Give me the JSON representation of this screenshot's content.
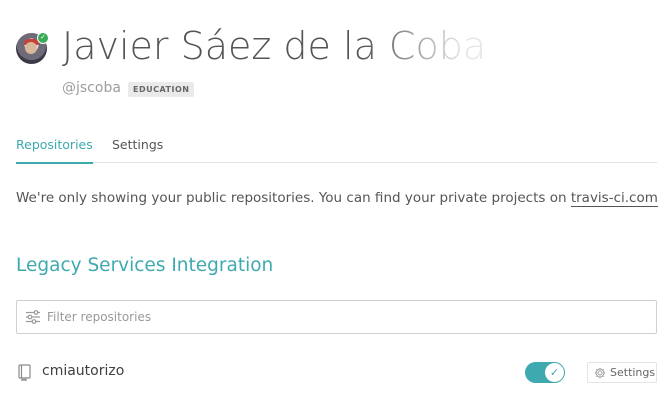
{
  "profile": {
    "name": "Javier Sáez de la Coba",
    "handle": "@jscoba",
    "badge": "EDUCATION",
    "avatar_icon": "user-avatar",
    "status_icon": "check-icon"
  },
  "tabs": [
    {
      "label": "Repositories",
      "active": true
    },
    {
      "label": "Settings",
      "active": false
    }
  ],
  "notice": {
    "text": "We're only showing your public repositories. You can find your private projects on",
    "link_text": "travis-ci.com",
    "suffix": "."
  },
  "section": {
    "title": "Legacy Services Integration"
  },
  "filter": {
    "placeholder": "Filter repositories",
    "value": ""
  },
  "repositories": [
    {
      "name": "cmiautorizo",
      "active": true,
      "settings_label": "Settings"
    }
  ],
  "colors": {
    "accent": "#3eaaaf",
    "status_green": "#39aa56"
  }
}
